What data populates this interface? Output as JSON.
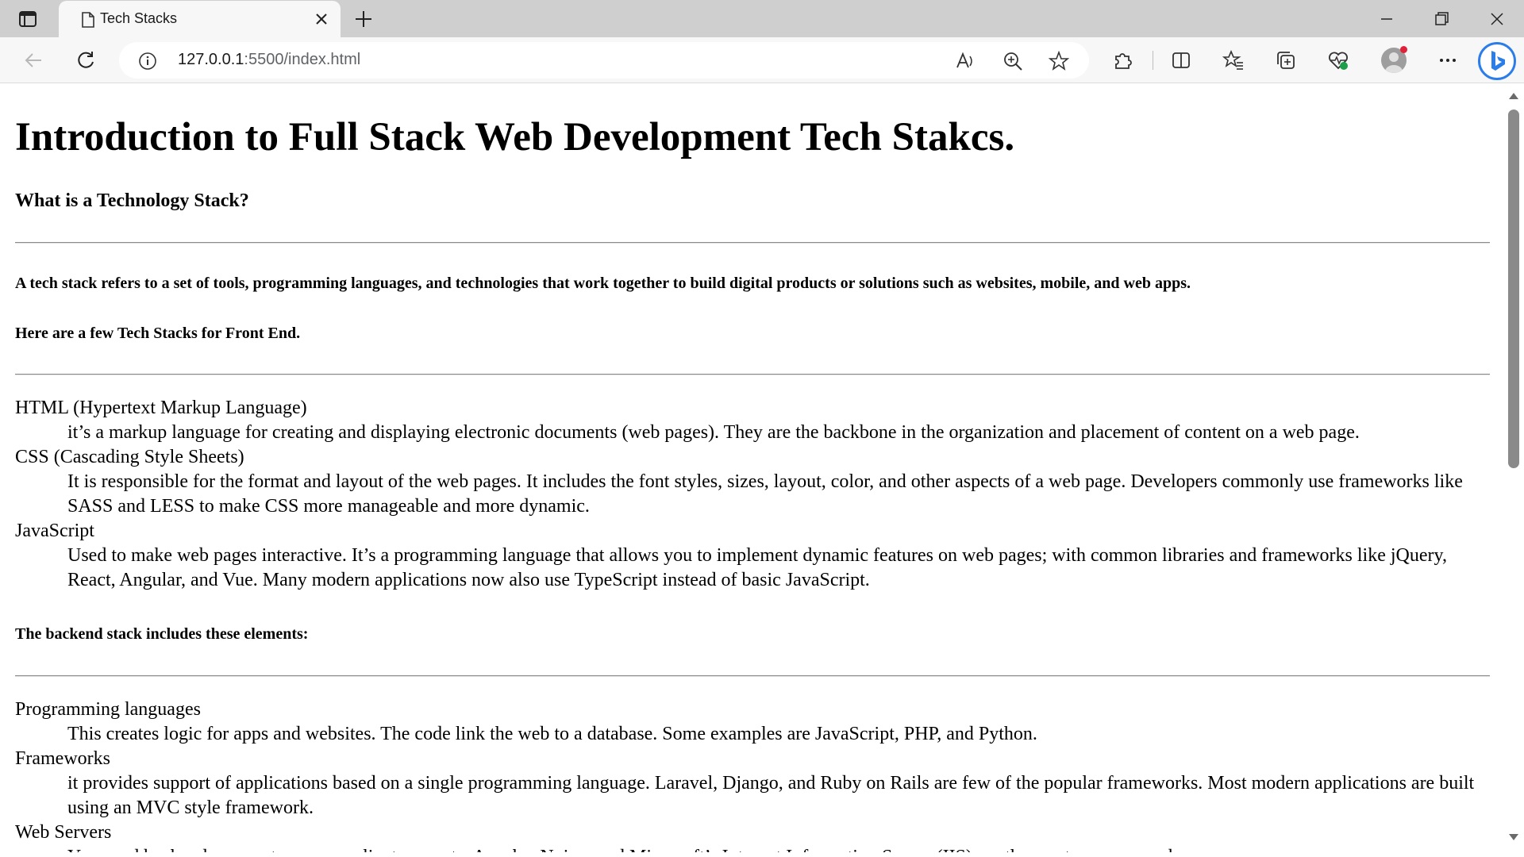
{
  "browser": {
    "tab_title": "Tech Stacks",
    "address": {
      "host": "127.0.0.1",
      "path": ":5500/index.html"
    }
  },
  "icons": {
    "sidebar": "sidebar-toggle-icon",
    "favicon": "page-icon",
    "close": "close-icon",
    "new_tab": "plus-icon",
    "minimize": "minimize-icon",
    "restore": "restore-icon",
    "window_close": "close-icon",
    "back": "back-arrow-icon",
    "refresh": "refresh-icon",
    "info": "info-icon",
    "read_aloud": "read-aloud-icon",
    "zoom": "zoom-icon",
    "favorite": "star-icon",
    "extensions": "puzzle-icon",
    "split": "split-screen-icon",
    "favorites": "favorites-icon",
    "collections": "collections-icon",
    "performance": "heart-icon",
    "more": "more-icon",
    "copilot": "bing-icon"
  },
  "page": {
    "title": "Introduction to Full Stack Web Development Tech Stakcs.",
    "question": "What is a Technology Stack?",
    "definition": "A tech stack refers to a set of tools, programming languages, and technologies that work together to build digital products or solutions such as websites, mobile, and web apps.",
    "frontend_heading": "Here are a few Tech Stacks for Front End.",
    "frontend": [
      {
        "term": "HTML (Hypertext Markup Language)",
        "desc": "it’s a markup language for creating and displaying electronic documents (web pages). They are the backbone in the organization and placement of content on a web page."
      },
      {
        "term": "CSS (Cascading Style Sheets)",
        "desc": "It is responsible for the format and layout of the web pages. It includes the font styles, sizes, layout, color, and other aspects of a web page. Developers commonly use frameworks like SASS and LESS to make CSS more manageable and more dynamic."
      },
      {
        "term": "JavaScript",
        "desc": "Used to make web pages interactive. It’s a programming language that allows you to implement dynamic features on web pages; with common libraries and frameworks like jQuery, React, Angular, and Vue. Many modern applications now also use TypeScript instead of basic JavaScript."
      }
    ],
    "backend_heading": "The backend stack includes these elements:",
    "backend": [
      {
        "term": "Programming languages",
        "desc": "This creates logic for apps and websites. The code link the web to a database. Some examples are JavaScript, PHP, and Python."
      },
      {
        "term": "Frameworks",
        "desc": "it provides support of applications based on a single programming language. Laravel, Django, and Ruby on Rails are few of the popular frameworks. Most modern applications are built using an MVC style framework."
      },
      {
        "term": "Web Servers",
        "desc": "You need backend servers to manage client requests. Apache, Nginx, and Microsoft’s Internet Information Server (IIS) are the most common web servers."
      }
    ]
  }
}
